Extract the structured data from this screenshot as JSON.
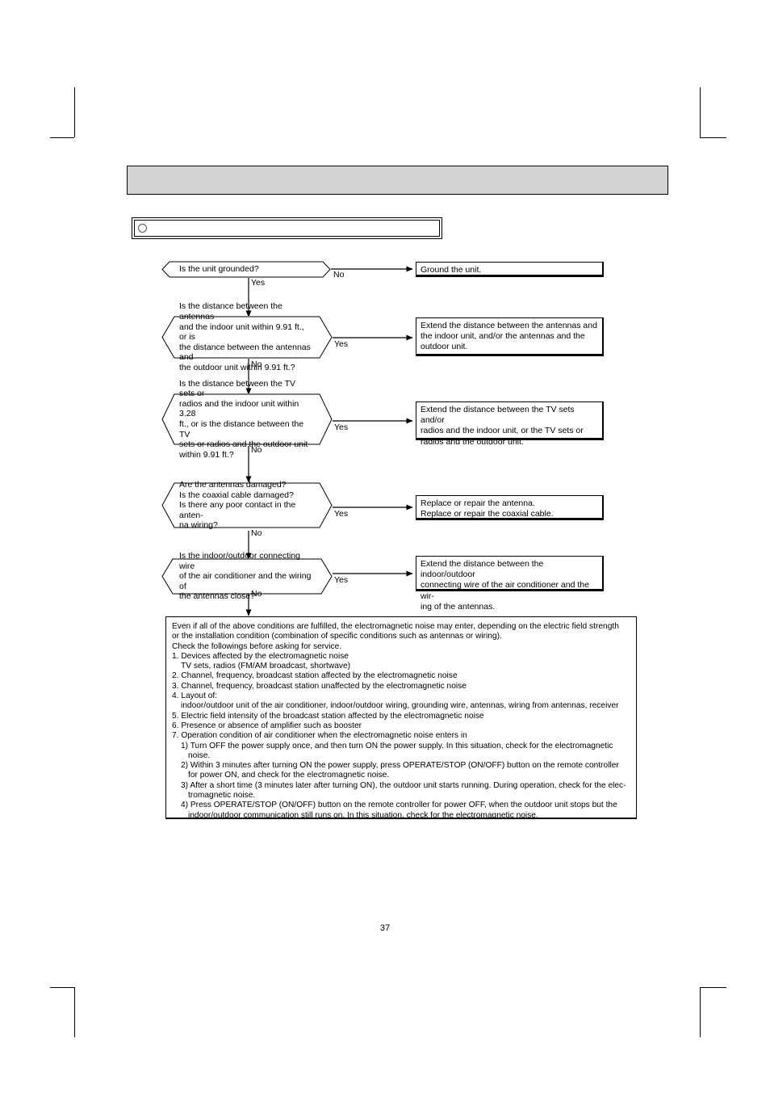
{
  "page": {
    "number": "37"
  },
  "header": {
    "bar_text": ""
  },
  "title": {
    "bullet_icon": "circle-icon",
    "text": ""
  },
  "flowchart": {
    "yes_label": "Yes",
    "no_label": "No",
    "nodes": [
      {
        "id": "grounded",
        "question": "Is the unit grounded?",
        "branch_to_result": "No",
        "branch_continue": "Yes",
        "result": "Ground the unit."
      },
      {
        "id": "antenna-distance",
        "question": "Is the distance between the antennas\nand the indoor unit within 9.91 ft., or is\nthe distance between the antennas and\nthe outdoor unit within 9.91 ft.?",
        "branch_to_result": "Yes",
        "branch_continue": "No",
        "result": "Extend the distance between the antennas and\nthe indoor unit, and/or the antennas and the\noutdoor unit."
      },
      {
        "id": "tv-radio-distance",
        "question": "Is the distance between the TV sets or\nradios and the indoor unit within 3.28\nft., or is the distance between the TV\nsets or radios and the outdoor unit\nwithin 9.91 ft.?",
        "branch_to_result": "Yes",
        "branch_continue": "No",
        "result": "Extend the distance between the TV sets and/or\nradios and the indoor unit, or the TV sets or\nradios and the outdoor unit."
      },
      {
        "id": "antenna-damage",
        "question": "Are the antennas damaged?\nIs the coaxial cable damaged?\nIs there any poor contact in the anten-\nna wiring?",
        "branch_to_result": "Yes",
        "branch_continue": "No",
        "result": "Replace or repair the antenna.\nReplace or repair the coaxial cable."
      },
      {
        "id": "wiring-proximity",
        "question": "Is the indoor/outdoor connecting wire\nof the air conditioner and the wiring of\nthe antennas close?",
        "branch_to_result": "Yes",
        "branch_continue": "No",
        "result": "Extend the distance between the indoor/outdoor\nconnecting wire of the air conditioner and the wir-\ning of the antennas."
      }
    ]
  },
  "note": {
    "lines": [
      {
        "text": "Even if all of the above conditions are fulfilled, the electromagnetic noise may enter, depending on the electric field strength",
        "indent": 0
      },
      {
        "text": "or the installation condition (combination of specific conditions such as antennas or wiring).",
        "indent": 0
      },
      {
        "text": "Check the followings before asking for service.",
        "indent": 0
      },
      {
        "text": "1. Devices affected by the electromagnetic noise",
        "indent": 0
      },
      {
        "text": "TV sets, radios (FM/AM broadcast, shortwave)",
        "indent": 1
      },
      {
        "text": "2. Channel, frequency, broadcast station affected by the electromagnetic noise",
        "indent": 0
      },
      {
        "text": "3. Channel, frequency, broadcast station unaffected by the electromagnetic noise",
        "indent": 0
      },
      {
        "text": "4. Layout of:",
        "indent": 0
      },
      {
        "text": "indoor/outdoor unit of the air conditioner, indoor/outdoor wiring, grounding wire, antennas, wiring from antennas, receiver",
        "indent": 1
      },
      {
        "text": "5. Electric field intensity of the broadcast station affected by the electromagnetic noise",
        "indent": 0
      },
      {
        "text": "6. Presence or absence of amplifier such as booster",
        "indent": 0
      },
      {
        "text": "7. Operation condition of air conditioner when the electromagnetic noise enters in",
        "indent": 0
      },
      {
        "text": "1) Turn OFF the power supply once, and then turn ON the power supply. In this situation, check for the electromagnetic",
        "indent": 1
      },
      {
        "text": "noise.",
        "indent": 2
      },
      {
        "text": "2) Within 3 minutes after turning ON the power supply, press OPERATE/STOP (ON/OFF) button on the remote controller",
        "indent": 1
      },
      {
        "text": "for power ON, and check for the electromagnetic noise.",
        "indent": 2
      },
      {
        "text": "3) After a short time (3 minutes later after turning ON), the outdoor unit starts running. During operation, check for the elec-",
        "indent": 1
      },
      {
        "text": "tromagnetic noise.",
        "indent": 2
      },
      {
        "text": "4) Press OPERATE/STOP (ON/OFF) button on the remote controller for power OFF, when the outdoor unit stops but the",
        "indent": 1
      },
      {
        "text": "indoor/outdoor communication still runs on. In this situation, check for the electromagnetic noise.",
        "indent": 2
      }
    ]
  }
}
